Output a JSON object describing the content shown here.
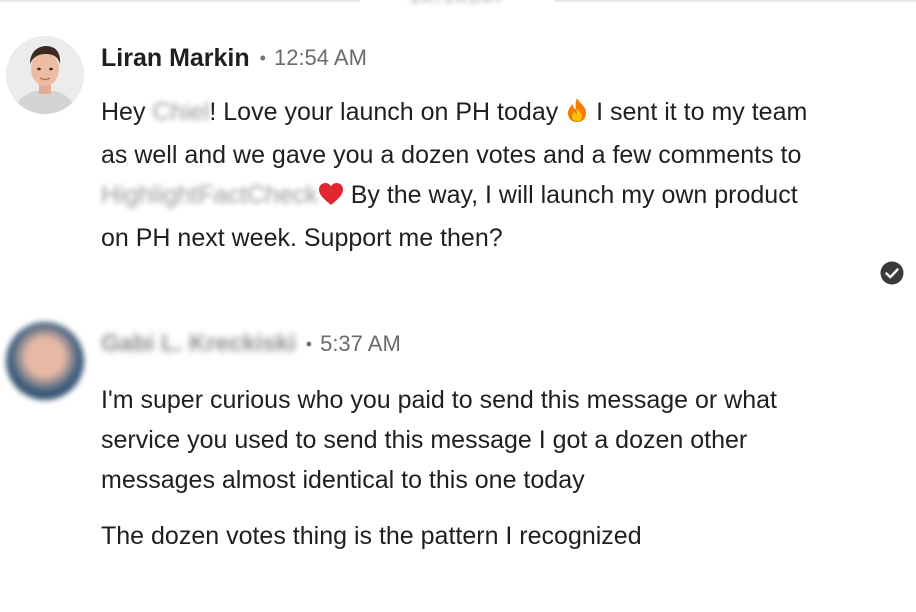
{
  "day_label": "SATURDAY",
  "messages": [
    {
      "sender": "Liran Markin",
      "time": "12:54 AM",
      "body": {
        "t1": "Hey ",
        "mention": "Chiel",
        "t2": "! Love your launch on PH today ",
        "t3": " I sent it to my team as well and we gave you a dozen votes and a few comments to ",
        "product": "HighlightFactCheck",
        "t4": " By the way, I will launch my own product on PH next week. Support me then?"
      },
      "emojis": [
        "fire-emoji",
        "red-heart-emoji"
      ]
    },
    {
      "sender": "Gabi L. Kreckiski",
      "time": "5:37 AM",
      "paragraphs": [
        "I'm super curious who you paid to send this message or what service you used to send this message I got a dozen other messages almost identical to this one today",
        "The dozen votes thing is the pattern I recognized"
      ]
    }
  ],
  "colors": {
    "text": "#1f1f1f",
    "timestamp": "#6b6b6b",
    "fire": "#f57c00",
    "heart": "#e0262f",
    "receipt": "#3a3a3a"
  }
}
